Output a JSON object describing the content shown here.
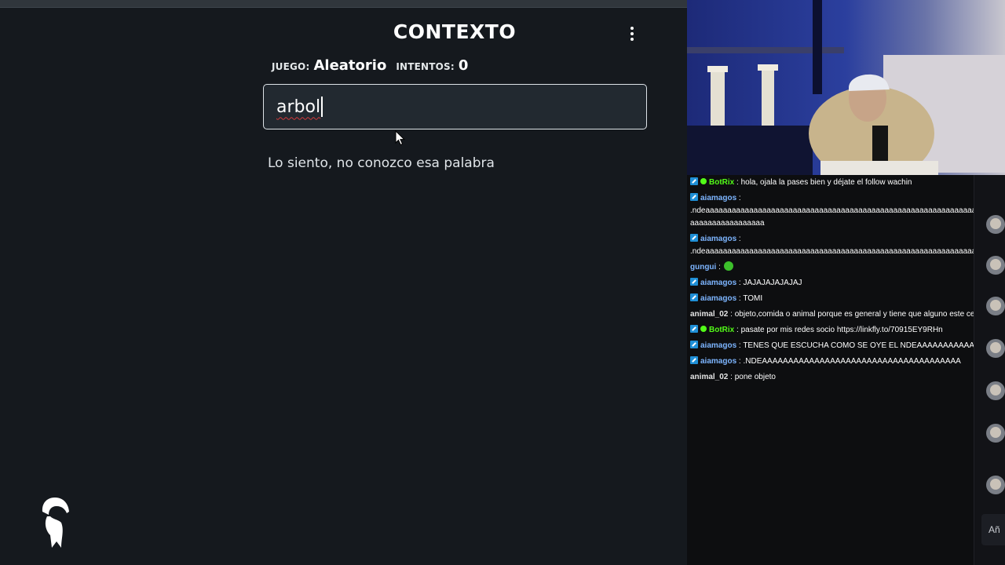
{
  "game": {
    "title": "CONTEXTO",
    "mode_label": "JUEGO:",
    "mode_value": "Aleatorio",
    "attempts_label": "INTENTOS:",
    "attempts_value": "0",
    "input_value": "arbol",
    "message": "Lo siento, no conozco esa palabra",
    "menu_icon": "more-vertical-icon",
    "logo_icon": "toucan-logo-icon"
  },
  "chat": {
    "messages": [
      {
        "user": "BotRix",
        "sep": ":",
        "text": "hola, ojala la pases bien y déjate el follow wachin"
      },
      {
        "user": "aiamagos",
        "sep": ":",
        "text": ".ndeaaaaaaaaaaaaaaaaaaaaaaaaaaaaaaaaaaaaaaaaaaaaaaaaaaaaaaaaaaaaaaaaaaaaaaaaaaaaaaaaaaaa"
      },
      {
        "user": "aiamagos",
        "sep": ":",
        "text": ".ndeaaaaaaaaaaaaaaaaaaaaaaaaaaaaaaaaaaaaaaaaaaaaaaaaaaaaaaaaaaaaaa"
      },
      {
        "user": "gungui",
        "sep": ":",
        "text": ""
      },
      {
        "user": "aiamagos",
        "sep": ":",
        "text": "JAJAJAJAJAJAJ"
      },
      {
        "user": "aiamagos",
        "sep": ":",
        "text": "TOMI"
      },
      {
        "user": "animal_02",
        "sep": ":",
        "text": "objeto,comida o animal porque es general y tiene que alguno este cerca"
      },
      {
        "user": "BotRix",
        "sep": ":",
        "text": "pasate por mis redes socio https://linkfly.to/70915EY9RHn"
      },
      {
        "user": "aiamagos",
        "sep": ":",
        "text": "TENES QUE ESCUCHA COMO SE OYE EL NDEAAAAAAAAAAAAAAA"
      },
      {
        "user": "aiamagos",
        "sep": ":",
        "text": ".NDEAAAAAAAAAAAAAAAAAAAAAAAAAAAAAAAAAAAAAA"
      },
      {
        "user": "animal_02",
        "sep": ":",
        "text": "pone objeto"
      }
    ],
    "add_tab_label": "Añ"
  }
}
